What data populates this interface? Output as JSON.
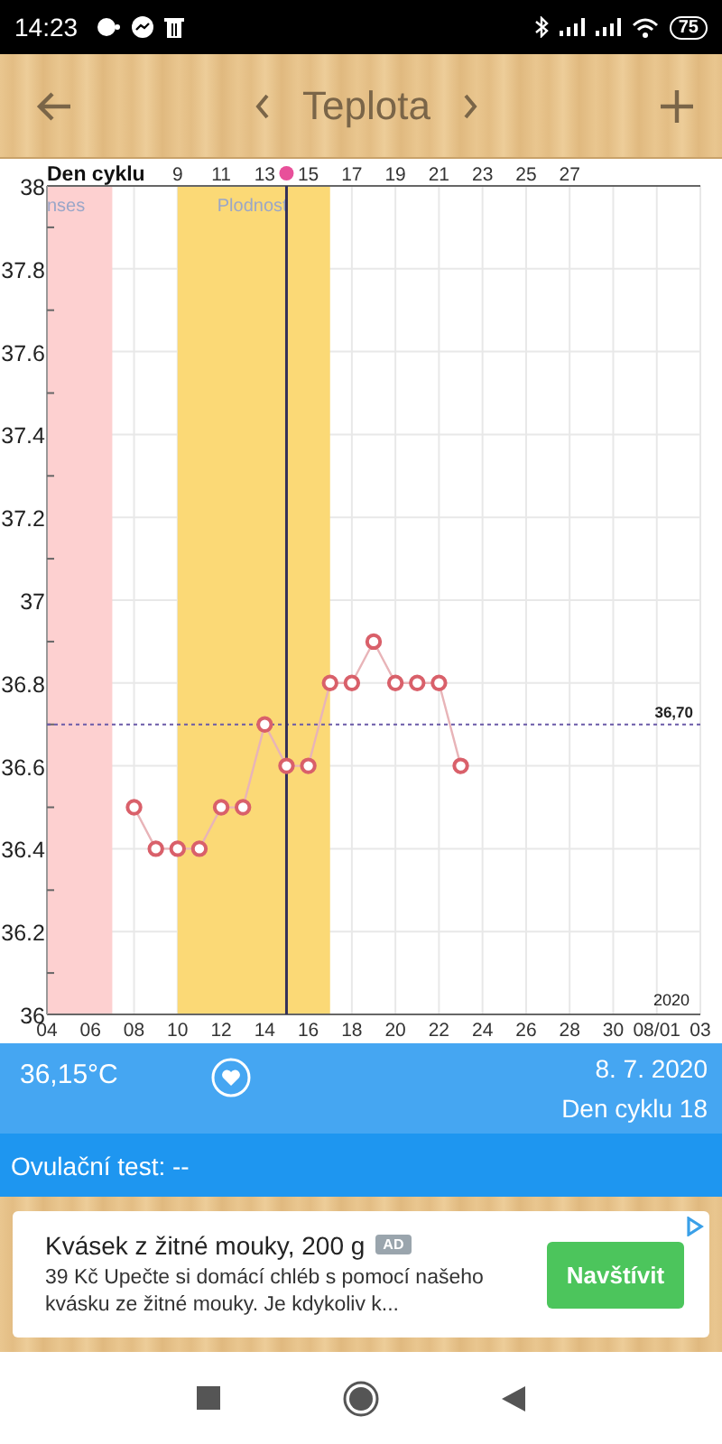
{
  "status_bar": {
    "time": "14:23",
    "battery": "75"
  },
  "header": {
    "title": "Teplota"
  },
  "chart": {
    "top_axis": {
      "label": "Den cyklu",
      "ticks": [
        "9",
        "11",
        "13",
        "15",
        "17",
        "19",
        "21",
        "23",
        "25",
        "27"
      ]
    },
    "year": "2020",
    "chart_data": {
      "type": "line",
      "grid": true,
      "x": [
        "2020-07-08",
        "2020-07-09",
        "2020-07-10",
        "2020-07-11",
        "2020-07-12",
        "2020-07-13",
        "2020-07-14",
        "2020-07-15",
        "2020-07-16",
        "2020-07-17",
        "2020-07-18",
        "2020-07-19",
        "2020-07-20",
        "2020-07-21",
        "2020-07-22",
        "2020-07-23"
      ],
      "series": [
        {
          "color": "#d9606a",
          "marker": "o",
          "values": [
            36.5,
            36.4,
            36.4,
            36.4,
            36.5,
            36.5,
            36.7,
            36.6,
            36.6,
            36.8,
            36.8,
            36.9,
            36.8,
            36.8,
            36.8,
            36.6
          ]
        }
      ],
      "xlim": [
        "2020-07-04",
        "2020-08-03"
      ],
      "ylim": [
        36,
        38
      ],
      "xticks": [
        {
          "value": "2020-07-04",
          "label": "04"
        },
        {
          "value": "2020-07-06",
          "label": "06"
        },
        {
          "value": "2020-07-08",
          "label": "08"
        },
        {
          "value": "2020-07-10",
          "label": "10"
        },
        {
          "value": "2020-07-12",
          "label": "12"
        },
        {
          "value": "2020-07-14",
          "label": "14"
        },
        {
          "value": "2020-07-16",
          "label": "16"
        },
        {
          "value": "2020-07-18",
          "label": "18"
        },
        {
          "value": "2020-07-20",
          "label": "20"
        },
        {
          "value": "2020-07-22",
          "label": "22"
        },
        {
          "value": "2020-07-24",
          "label": "24"
        },
        {
          "value": "2020-07-26",
          "label": "26"
        },
        {
          "value": "2020-07-28",
          "label": "28"
        },
        {
          "value": "2020-07-30",
          "label": "30"
        },
        {
          "value": "2020-08-01",
          "label": "08/01"
        },
        {
          "value": "2020-08-03",
          "label": "03"
        }
      ],
      "yticks": [
        {
          "value": 36,
          "label": "36"
        },
        {
          "value": 36.2,
          "label": "36.2"
        },
        {
          "value": 36.4,
          "label": "36.4"
        },
        {
          "value": 36.6,
          "label": "36.6"
        },
        {
          "value": 36.8,
          "label": "36.8"
        },
        {
          "value": 37,
          "label": "37"
        },
        {
          "value": 37.2,
          "label": "37.2"
        },
        {
          "value": 37.4,
          "label": "37.4"
        },
        {
          "value": 37.6,
          "label": "37.6"
        },
        {
          "value": 37.8,
          "label": "37.8"
        },
        {
          "value": 38,
          "label": "38"
        }
      ],
      "bands": [
        {
          "axis": "x",
          "from": "2020-07-04",
          "to": "2020-07-07",
          "label": "nses",
          "color": "#fdd0d0"
        },
        {
          "axis": "x",
          "from": "2020-07-10",
          "to": "2020-07-17",
          "label": "Plodnost",
          "color": "#fbd976"
        }
      ],
      "ref_lines": [
        {
          "axis": "y",
          "value": 36.7,
          "label": "36,70",
          "color": "#6a5aa8"
        },
        {
          "axis": "x",
          "value": "2020-07-15",
          "color": "#33305a"
        }
      ]
    }
  },
  "info_bar": {
    "temperature": "36,15°C",
    "date": "8. 7. 2020",
    "cycle_day": "Den cyklu 18"
  },
  "ovulation": {
    "text": "Ovulační test: --"
  },
  "ad": {
    "title": "Kvásek z žitné mouky, 200 g",
    "badge": "AD",
    "text": "39 Kč Upečte si domácí chléb s pomocí našeho kvásku ze žitné mouky. Je kdykoliv k...",
    "button": "Navštívit"
  }
}
